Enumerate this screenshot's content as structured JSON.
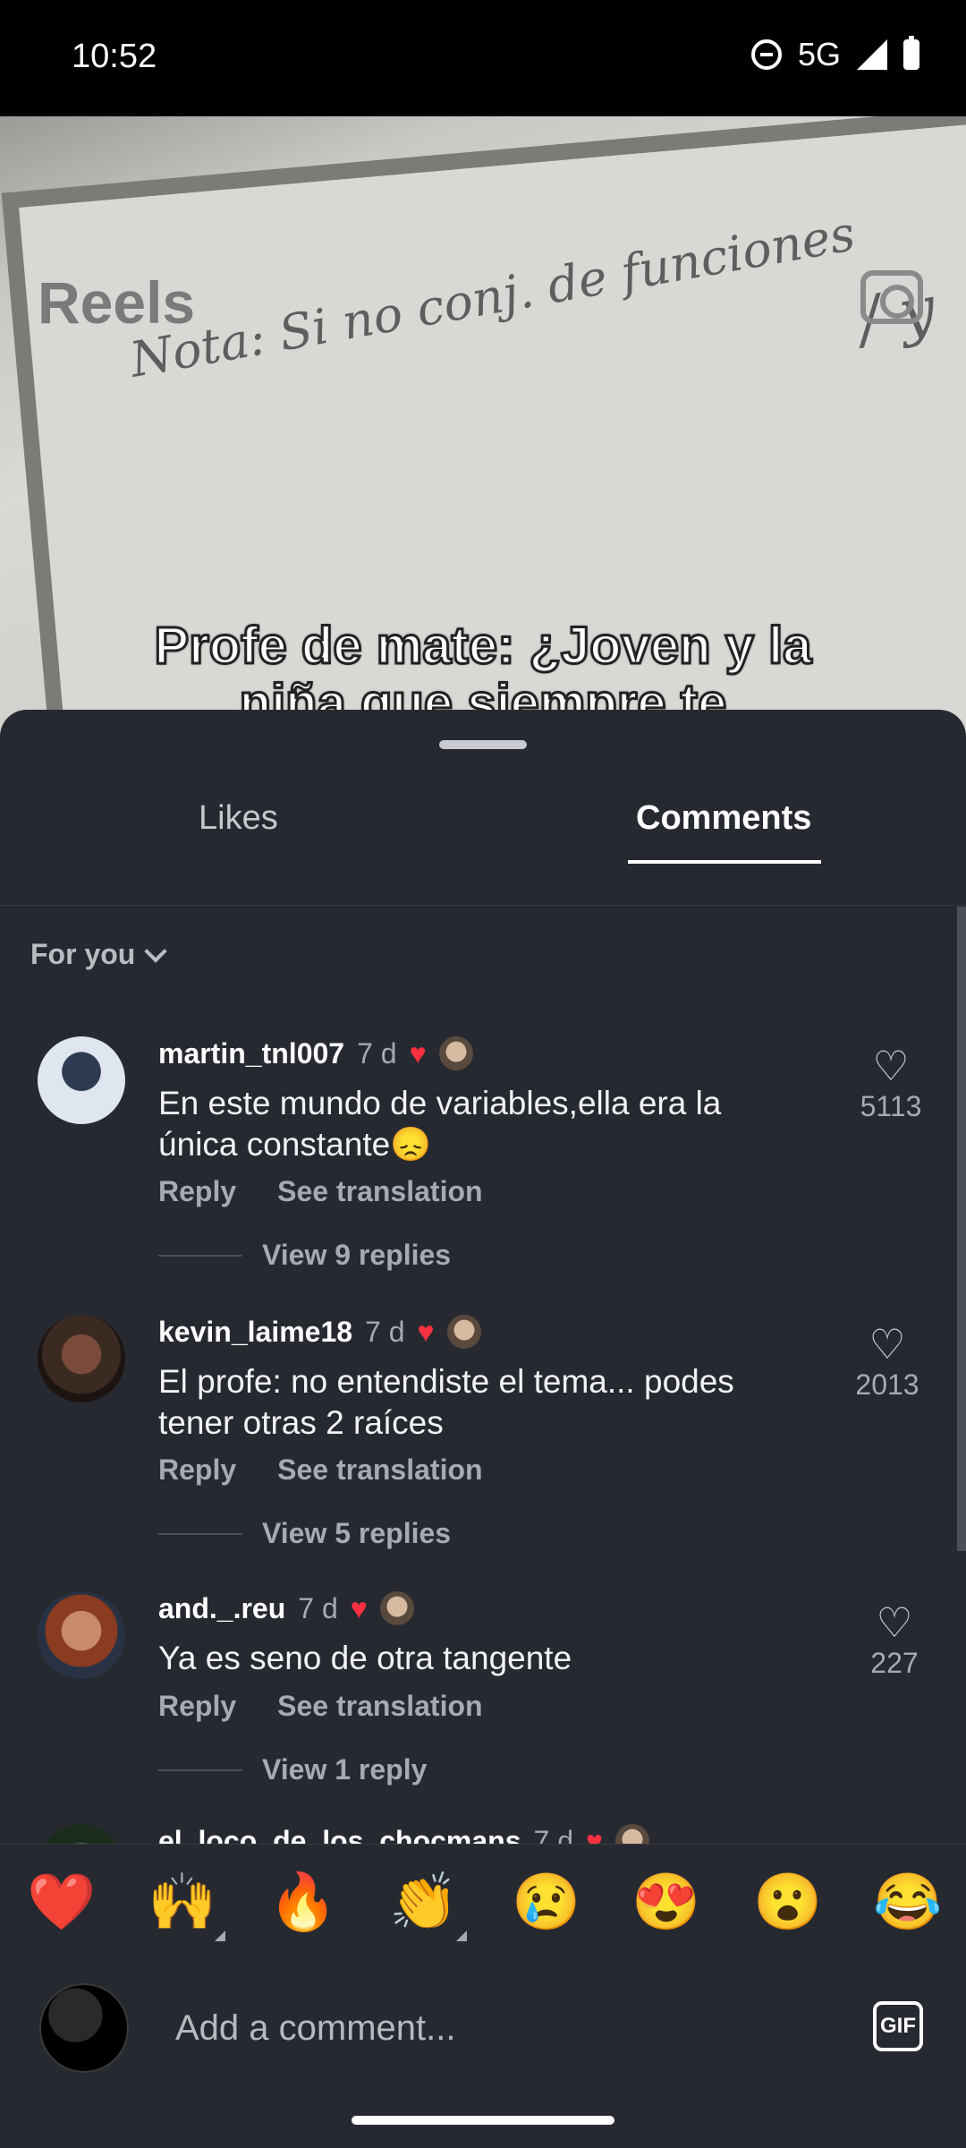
{
  "status_bar": {
    "time": "10:52",
    "network": "5G"
  },
  "screen": {
    "title": "Reels"
  },
  "video": {
    "caption": "Profe de mate: ¿Joven y la niña que siempre te acompañaba en clase?",
    "board_text": "Nota: Si no conj. de funciones"
  },
  "tabs": {
    "likes": "Likes",
    "comments": "Comments",
    "active": "Comments"
  },
  "sort": {
    "label": "For you"
  },
  "comments": [
    {
      "username": "martin_tnl007",
      "ago": "7 d",
      "text": "En este mundo de variables,ella era la única constante😞",
      "likes": "5113",
      "reply": "Reply",
      "translate": "See translation",
      "view_replies": "View 9 replies"
    },
    {
      "username": "kevin_laime18",
      "ago": "7 d",
      "text": "El profe: no entendiste el tema... podes tener otras 2 raíces",
      "likes": "2013",
      "reply": "Reply",
      "translate": "See translation",
      "view_replies": "View 5 replies"
    },
    {
      "username": "and._.reu",
      "ago": "7 d",
      "text": "Ya es seno de otra tangente",
      "likes": "227",
      "reply": "Reply",
      "translate": "See translation",
      "view_replies": "View 1 reply"
    },
    {
      "username": "el_loco_de_los_chocmans",
      "ago": "7 d"
    }
  ],
  "emoji_bar": [
    "❤️",
    "🙌",
    "🔥",
    "👏",
    "😢",
    "😍",
    "😮",
    "😂"
  ],
  "composer": {
    "placeholder": "Add a comment...",
    "gif_label": "GIF"
  },
  "colors": {
    "sheet_bg": "#262a30",
    "heart_red": "#ff3040",
    "muted_text": "#a7aab0"
  }
}
